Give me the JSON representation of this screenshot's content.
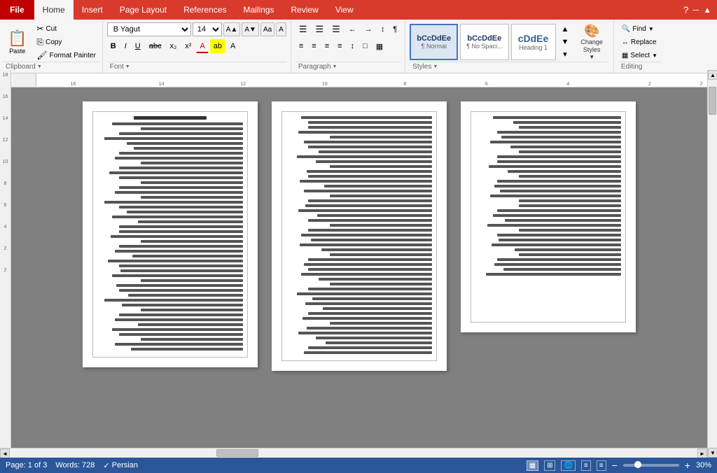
{
  "tabs": {
    "file": "File",
    "home": "Home",
    "insert": "Insert",
    "pageLayout": "Page Layout",
    "references": "References",
    "mailings": "Mailings",
    "review": "Review",
    "view": "View",
    "activeTab": "Home"
  },
  "clipboard": {
    "groupLabel": "Clipboard",
    "paste": "Paste",
    "cut": "Cut",
    "copy": "Copy",
    "formatPainter": "Format Painter"
  },
  "font": {
    "groupLabel": "Font",
    "fontName": "B Yagut",
    "fontSize": "14",
    "bold": "B",
    "italic": "I",
    "underline": "U",
    "strikethrough": "abc",
    "subscript": "x₂",
    "superscript": "x²",
    "fontColor": "A",
    "highlight": "ab",
    "clearFormatting": "A",
    "growFont": "A▲",
    "shrinkFont": "A▼",
    "changeCaseBtn": "Aa"
  },
  "paragraph": {
    "groupLabel": "Paragraph",
    "bullets": "≡",
    "numbering": "≡",
    "indent": "→",
    "outdent": "←",
    "sort": "↕",
    "showMarks": "¶",
    "alignLeft": "≡",
    "alignCenter": "≡",
    "alignRight": "≡",
    "justify": "≡",
    "lineSpacing": "↕",
    "shading": "□",
    "borders": "▦"
  },
  "styles": {
    "groupLabel": "Styles",
    "items": [
      {
        "id": "normal",
        "preview": "bCcDdEe",
        "label": "¶ Normal",
        "active": true
      },
      {
        "id": "noSpacing",
        "preview": "bCcDdEe",
        "label": "¶ No Spaci...",
        "active": false
      },
      {
        "id": "heading1",
        "preview": "cDdEe",
        "label": "Heading 1",
        "active": false
      }
    ],
    "changeStyles": "Change\nStyles"
  },
  "editing": {
    "groupLabel": "Editing",
    "find": "Find",
    "replace": "Replace",
    "select": "Select"
  },
  "statusBar": {
    "page": "Page: 1 of 3",
    "words": "Words: 728",
    "language": "Persian",
    "zoom": "30%"
  },
  "quickAccess": {
    "help": "?"
  }
}
